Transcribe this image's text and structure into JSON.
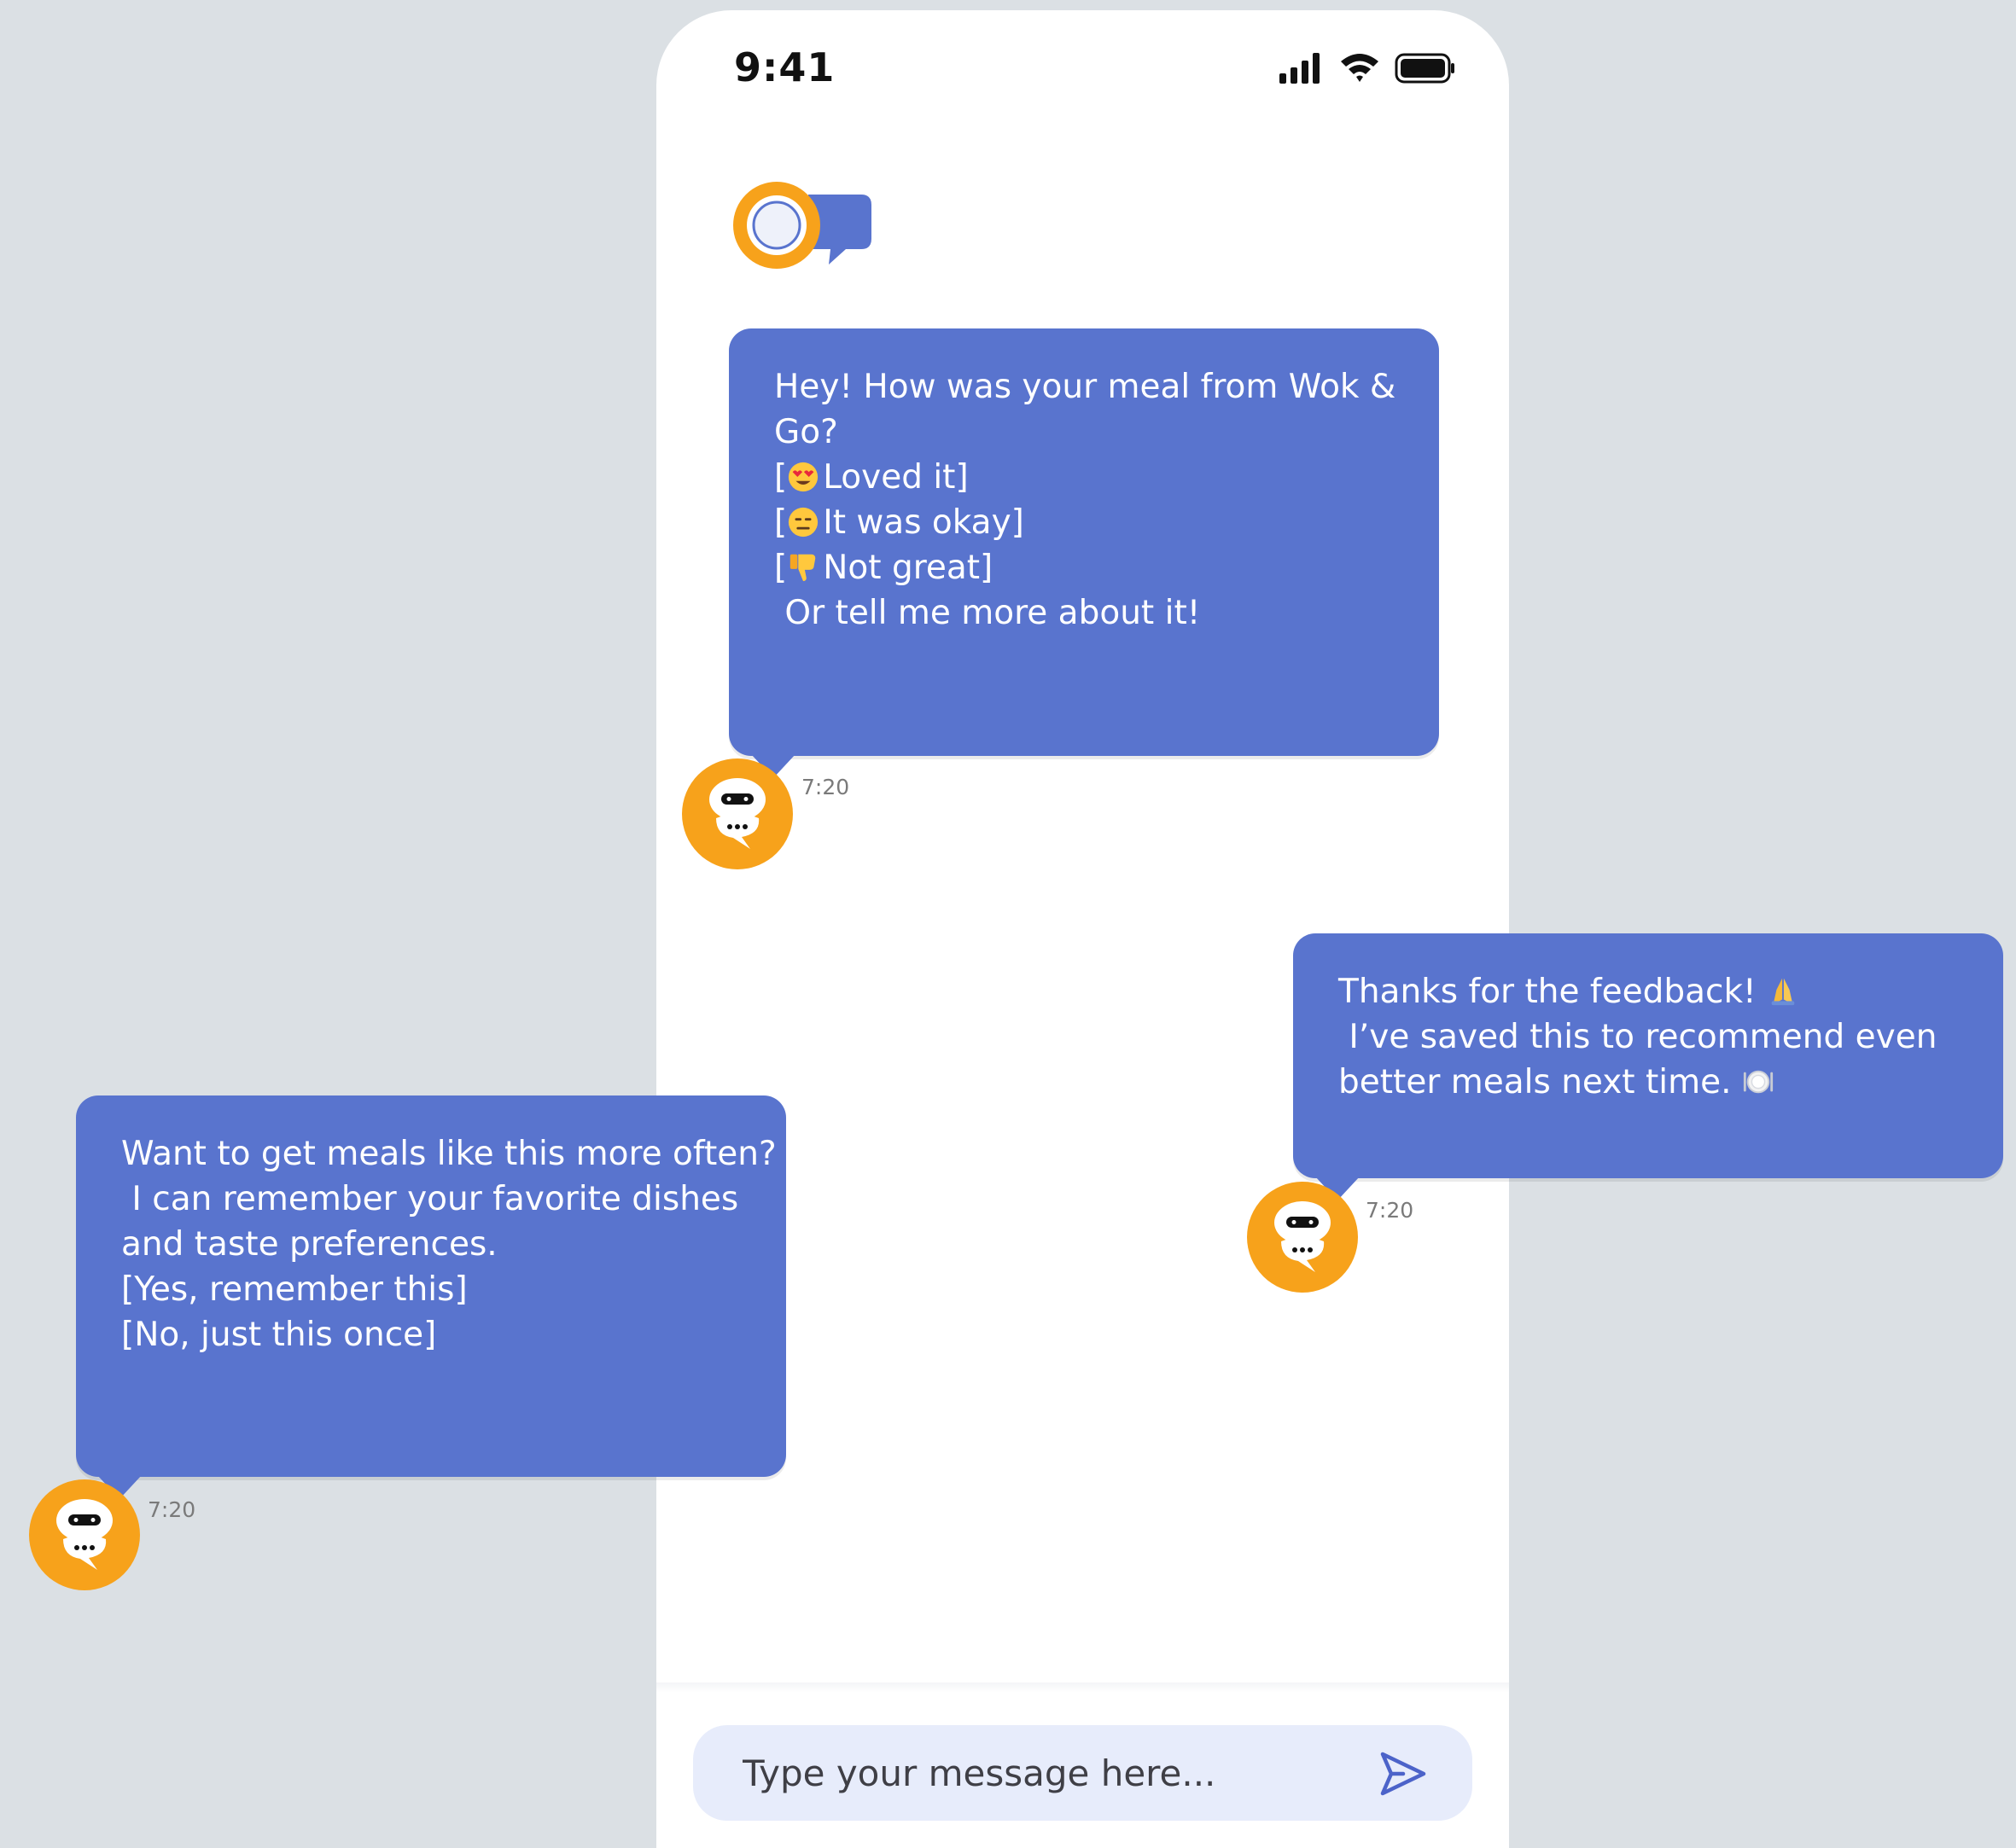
{
  "status_bar": {
    "time": "9:41",
    "icons": [
      "cellular-signal-icon",
      "wifi-icon",
      "battery-icon"
    ]
  },
  "app": {
    "logo": "chat-app-logo-icon"
  },
  "messages": [
    {
      "sender": "bot",
      "lines": [
        "Hey! How was your meal from Wok &",
        "Go?",
        "[😍 Loved it]",
        "[😑 It was okay]",
        "[👎 Not great]",
        "",
        " Or tell me more about it!"
      ],
      "time": "7:20"
    },
    {
      "sender": "bot",
      "lines": [
        "Thanks for the feedback! 🙏",
        " I’ve saved this to recommend even",
        "better meals next time. 🍽️"
      ],
      "time": "7:20"
    },
    {
      "sender": "bot",
      "lines": [
        "Want to get meals like this more often?",
        " I can remember your favorite dishes",
        "and taste preferences.",
        "",
        "[Yes, remember this]",
        "[No, just this once]"
      ],
      "time": "7:20"
    }
  ],
  "composer": {
    "placeholder": "Type your message here...",
    "send_icon": "send-icon"
  },
  "colors": {
    "background": "#DBE0E4",
    "bubble": "#5974CE",
    "avatar": "#F7A21B",
    "composer": "#E7ECFB",
    "accent": "#4C63C9"
  }
}
